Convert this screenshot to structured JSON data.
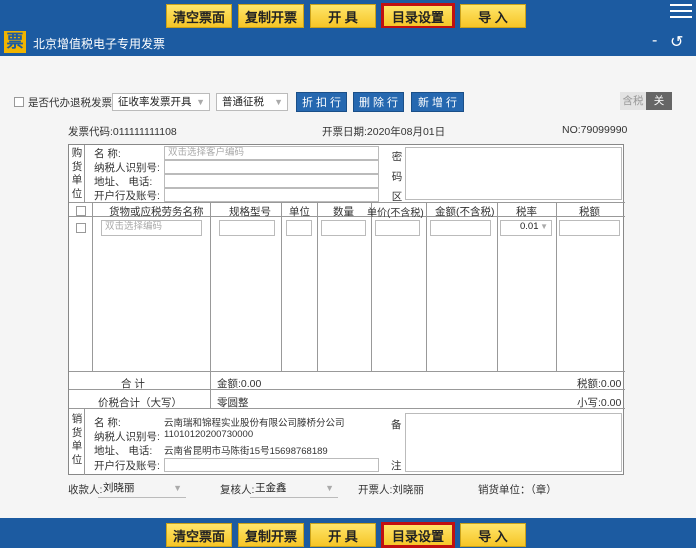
{
  "toolbar": {
    "clear": "清空票面",
    "copy": "复制开票",
    "issue": "开 具",
    "catalog": "目录设置",
    "import": "导 入"
  },
  "header": {
    "logo": "票",
    "title": "北京增值税电子专用发票",
    "minimize": "-",
    "back": "↺"
  },
  "options": {
    "agent_label": "是否代办退税发票",
    "collect_mode": "征收率发票开具",
    "tax_type": "普通征税",
    "discount": "折 扣 行",
    "delete_row": "删 除 行",
    "add_row": "新 增 行",
    "tax_incl": "含税",
    "tax_off": "关"
  },
  "invoice": {
    "code": "发票代码:011111111108",
    "date": "开票日期:2020年08月01日",
    "no": "NO:79099990"
  },
  "buyer": {
    "side": [
      "购",
      "货",
      "单",
      "位"
    ],
    "name_label": "名        称:",
    "name_placeholder": "双击选择客户编码",
    "taxid_label": "纳税人识别号:",
    "addr_label": "地址、   电话:",
    "bank_label": "开户行及账号:",
    "cipher": [
      "密",
      "码",
      "区"
    ]
  },
  "items": {
    "headers": [
      "货物或应税劳务名称",
      "规格型号",
      "单位",
      "数量",
      "单价(不含税)",
      "金额(不含税)",
      "税率",
      "税额"
    ],
    "name_placeholder": "双击选择编码",
    "rate": "0.01"
  },
  "totals": {
    "total_label": "合    计",
    "amount": "金额:0.00",
    "tax": "税额:0.00",
    "grand_label": "价税合计（大写）",
    "grand_words": "零圆整",
    "grand_small": "小写:0.00"
  },
  "seller": {
    "side": [
      "销",
      "货",
      "单",
      "位"
    ],
    "name_label": "名        称:",
    "name": "云南瑞和锦程实业股份有限公司滕桥分公司",
    "taxid_label": "纳税人识别号:",
    "taxid": "11010120200730000",
    "addr_label": "地址、   电话:",
    "addr": "云南省昆明市马陈街15号15698768189",
    "bank_label": "开户行及账号:",
    "remark": [
      "备",
      "注"
    ]
  },
  "signers": {
    "payee_label": "收款人:",
    "payee": "刘晓丽",
    "reviewer_label": "复核人:",
    "reviewer": "王金鑫",
    "drawer": "开票人:刘晓丽",
    "seller_unit": "销货单位：（章）"
  },
  "colors": {
    "brand_blue": "#1c5ba1",
    "button_yellow": "#f6c526",
    "highlight_red": "#c01010"
  }
}
